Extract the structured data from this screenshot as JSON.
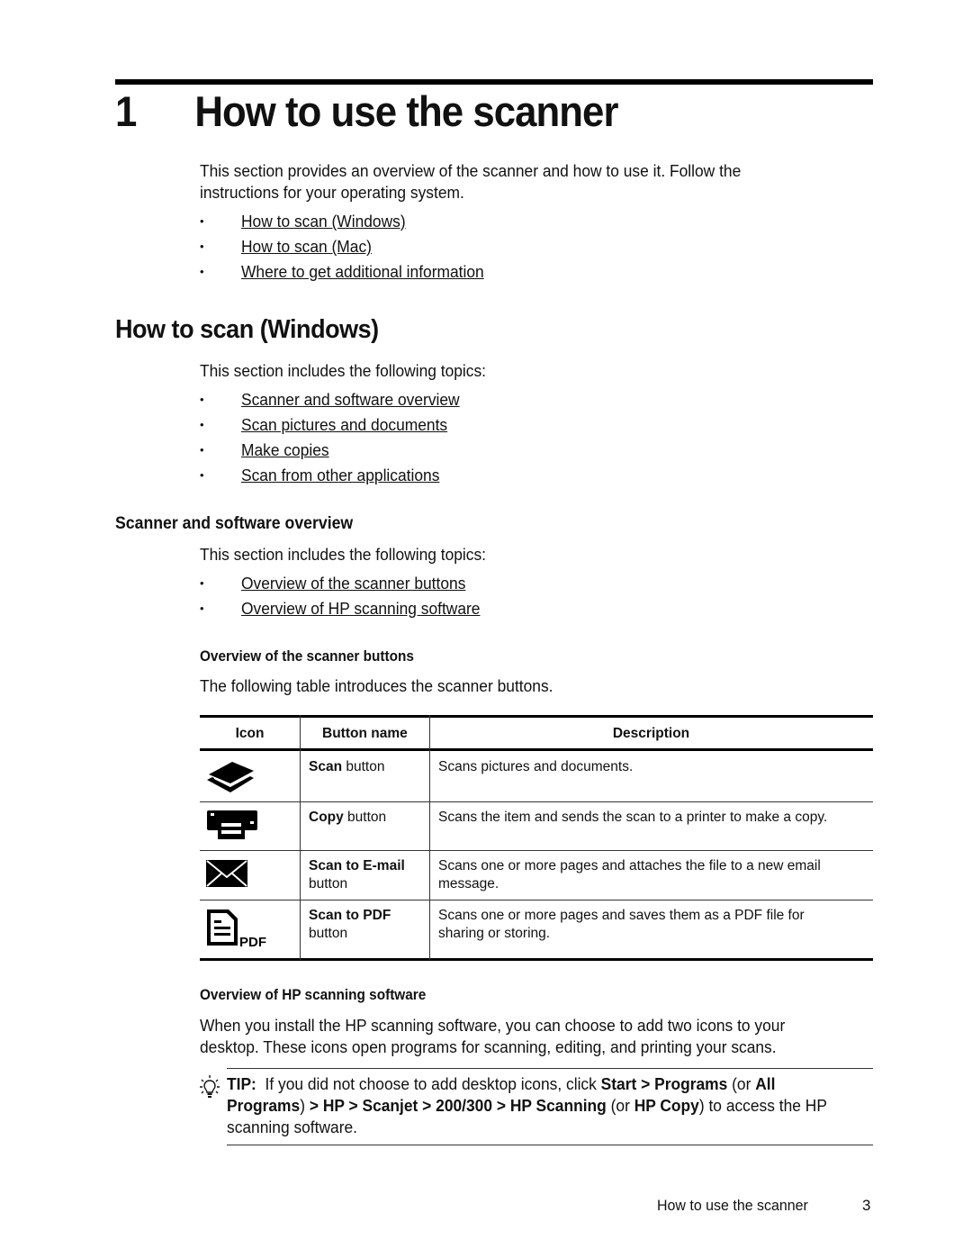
{
  "chapter": {
    "number": "1",
    "title": "How to use the scanner",
    "intro_line1": "This section provides an overview of the scanner and how to use it. Follow the",
    "intro_line2": "instructions for your operating system.",
    "links": [
      {
        "label": "How to scan (Windows)"
      },
      {
        "label": "How to scan (Mac)"
      },
      {
        "label": "Where to get additional information"
      }
    ]
  },
  "section_windows": {
    "heading": "How to scan (Windows)",
    "intro": "This section includes the following topics:",
    "links": [
      {
        "label": "Scanner and software overview"
      },
      {
        "label": "Scan pictures and documents"
      },
      {
        "label": "Make copies"
      },
      {
        "label": "Scan from other applications"
      }
    ]
  },
  "subsection_overview": {
    "heading": "Scanner and software overview",
    "intro": "This section includes the following topics:",
    "links": [
      {
        "label": "Overview of the scanner buttons"
      },
      {
        "label": "Overview of HP scanning software"
      }
    ]
  },
  "buttons_overview": {
    "heading": "Overview of the scanner buttons",
    "intro": "The following table introduces the scanner buttons.",
    "table": {
      "headers": [
        "Icon",
        "Button name",
        "Description"
      ],
      "rows": [
        {
          "icon": "scanner-flatbed-icon",
          "name_bold": "Scan",
          "name_rest": " button",
          "name_line2": "",
          "desc_line1": "Scans pictures and documents.",
          "desc_line2": ""
        },
        {
          "icon": "printer-copy-icon",
          "name_bold": "Copy",
          "name_rest": " button",
          "name_line2": "",
          "desc_line1": "Scans the item and sends the scan to a printer to make a copy.",
          "desc_line2": ""
        },
        {
          "icon": "envelope-email-icon",
          "name_bold": "Scan to E-mail",
          "name_rest": "",
          "name_line2": "button",
          "desc_line1": "Scans one or more pages and attaches the file to a new email",
          "desc_line2": "message."
        },
        {
          "icon": "pdf-document-icon",
          "name_bold": "Scan to PDF",
          "name_rest": "",
          "name_line2": "button",
          "desc_line1": "Scans one or more pages and saves them as a PDF file for",
          "desc_line2": "sharing or storing.",
          "icon_label": "PDF"
        }
      ]
    }
  },
  "software_overview": {
    "heading": "Overview of HP scanning software",
    "para_line1": "When you install the HP scanning software, you can choose to add two icons to your",
    "para_line2": "desktop. These icons open programs for scanning, editing, and printing your scans."
  },
  "tip": {
    "icon": "lightbulb-icon",
    "label": "TIP:",
    "t1": "  If you did not choose to add desktop icons, click ",
    "b1": "Start > Programs",
    "t2": " (or ",
    "b2": "All",
    "b3": "Programs",
    "t3": ") ",
    "b4": "> HP > Scanjet > 200/300 > HP Scanning",
    "t4": " (or ",
    "b5": "HP Copy",
    "t5": ") to access the HP",
    "t6": "scanning software."
  },
  "footer": {
    "chapter_title": "How to use the scanner",
    "page_number": "3"
  }
}
